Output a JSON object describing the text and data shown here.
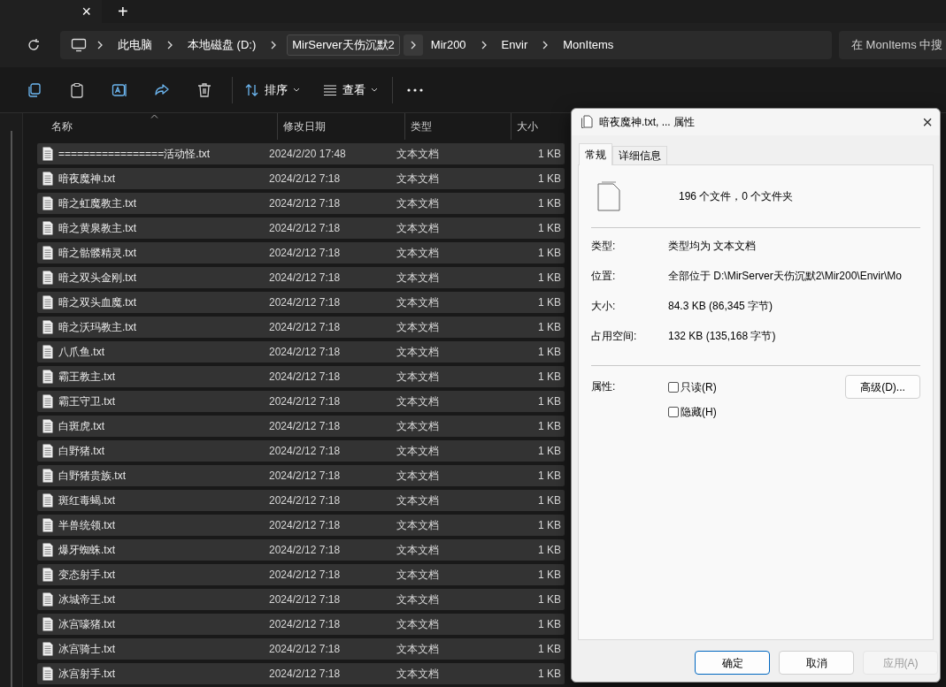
{
  "tab_strip": {
    "close": "×",
    "new": "+"
  },
  "address_bar": {
    "crumbs": [
      {
        "label": "此电脑",
        "highlighted": false
      },
      {
        "label": "本地磁盘 (D:)",
        "highlighted": false
      },
      {
        "label": "MirServer天伤沉默2",
        "highlighted": true
      },
      {
        "label": "Mir200",
        "highlighted": false
      },
      {
        "label": "Envir",
        "highlighted": false
      },
      {
        "label": "MonItems",
        "highlighted": false
      }
    ]
  },
  "search": {
    "placeholder": "在 MonItems 中搜"
  },
  "toolbar": {
    "sort": "排序",
    "view": "查看"
  },
  "file_list": {
    "columns": [
      "名称",
      "修改日期",
      "类型",
      "大小"
    ],
    "rows": [
      {
        "name": "=================活动怪.txt",
        "modified": "2024/2/20 17:48",
        "type": "文本文档",
        "size": "1 KB",
        "selected": true
      },
      {
        "name": "暗夜魔神.txt",
        "modified": "2024/2/12 7:18",
        "type": "文本文档",
        "size": "1 KB",
        "selected": true
      },
      {
        "name": "暗之虹魔教主.txt",
        "modified": "2024/2/12 7:18",
        "type": "文本文档",
        "size": "1 KB",
        "selected": true
      },
      {
        "name": "暗之黄泉教主.txt",
        "modified": "2024/2/12 7:18",
        "type": "文本文档",
        "size": "1 KB",
        "selected": true
      },
      {
        "name": "暗之骷髅精灵.txt",
        "modified": "2024/2/12 7:18",
        "type": "文本文档",
        "size": "1 KB",
        "selected": true
      },
      {
        "name": "暗之双头金刚.txt",
        "modified": "2024/2/12 7:18",
        "type": "文本文档",
        "size": "1 KB",
        "selected": true
      },
      {
        "name": "暗之双头血魔.txt",
        "modified": "2024/2/12 7:18",
        "type": "文本文档",
        "size": "1 KB",
        "selected": true
      },
      {
        "name": "暗之沃玛教主.txt",
        "modified": "2024/2/12 7:18",
        "type": "文本文档",
        "size": "1 KB",
        "selected": true
      },
      {
        "name": "八爪鱼.txt",
        "modified": "2024/2/12 7:18",
        "type": "文本文档",
        "size": "1 KB",
        "selected": true
      },
      {
        "name": "霸王教主.txt",
        "modified": "2024/2/12 7:18",
        "type": "文本文档",
        "size": "1 KB",
        "selected": true
      },
      {
        "name": "霸王守卫.txt",
        "modified": "2024/2/12 7:18",
        "type": "文本文档",
        "size": "1 KB",
        "selected": true
      },
      {
        "name": "白斑虎.txt",
        "modified": "2024/2/12 7:18",
        "type": "文本文档",
        "size": "1 KB",
        "selected": true
      },
      {
        "name": "白野猪.txt",
        "modified": "2024/2/12 7:18",
        "type": "文本文档",
        "size": "1 KB",
        "selected": true
      },
      {
        "name": "白野猪贵族.txt",
        "modified": "2024/2/12 7:18",
        "type": "文本文档",
        "size": "1 KB",
        "selected": true
      },
      {
        "name": "斑红毒蝎.txt",
        "modified": "2024/2/12 7:18",
        "type": "文本文档",
        "size": "1 KB",
        "selected": true
      },
      {
        "name": "半兽统领.txt",
        "modified": "2024/2/12 7:18",
        "type": "文本文档",
        "size": "1 KB",
        "selected": true
      },
      {
        "name": "爆牙蜘蛛.txt",
        "modified": "2024/2/12 7:18",
        "type": "文本文档",
        "size": "1 KB",
        "selected": true
      },
      {
        "name": "变态射手.txt",
        "modified": "2024/2/12 7:18",
        "type": "文本文档",
        "size": "1 KB",
        "selected": true
      },
      {
        "name": "冰城帝王.txt",
        "modified": "2024/2/12 7:18",
        "type": "文本文档",
        "size": "1 KB",
        "selected": true
      },
      {
        "name": "冰宫嚎猪.txt",
        "modified": "2024/2/12 7:18",
        "type": "文本文档",
        "size": "1 KB",
        "selected": true
      },
      {
        "name": "冰宫骑士.txt",
        "modified": "2024/2/12 7:18",
        "type": "文本文档",
        "size": "1 KB",
        "selected": true
      },
      {
        "name": "冰宫射手.txt",
        "modified": "2024/2/12 7:18",
        "type": "文本文档",
        "size": "1 KB",
        "selected": true
      }
    ]
  },
  "dialog": {
    "title": "暗夜魔神.txt, ... 属性",
    "close": "×",
    "tabs": [
      {
        "label": "常规",
        "selected": true
      },
      {
        "label": "详细信息",
        "selected": false
      }
    ],
    "summary": "196 个文件，0 个文件夹",
    "properties": [
      {
        "label": "类型:",
        "value": "类型均为 文本文档"
      },
      {
        "label": "位置:",
        "value": "全部位于 D:\\MirServer天伤沉默2\\Mir200\\Envir\\Mo"
      },
      {
        "label": "大小:",
        "value": "84.3 KB (86,345 字节)"
      },
      {
        "label": "占用空间:",
        "value": "132 KB (135,168 字节)"
      }
    ],
    "attributes_label": "属性:",
    "attributes": [
      {
        "label": "只读(R)",
        "checked": false
      },
      {
        "label": "隐藏(H)",
        "checked": false
      }
    ],
    "advanced_button": "高级(D)...",
    "buttons": [
      {
        "label": "确定",
        "kind": "default"
      },
      {
        "label": "取消",
        "kind": "normal"
      },
      {
        "label": "应用(A)",
        "kind": "disabled"
      }
    ]
  }
}
